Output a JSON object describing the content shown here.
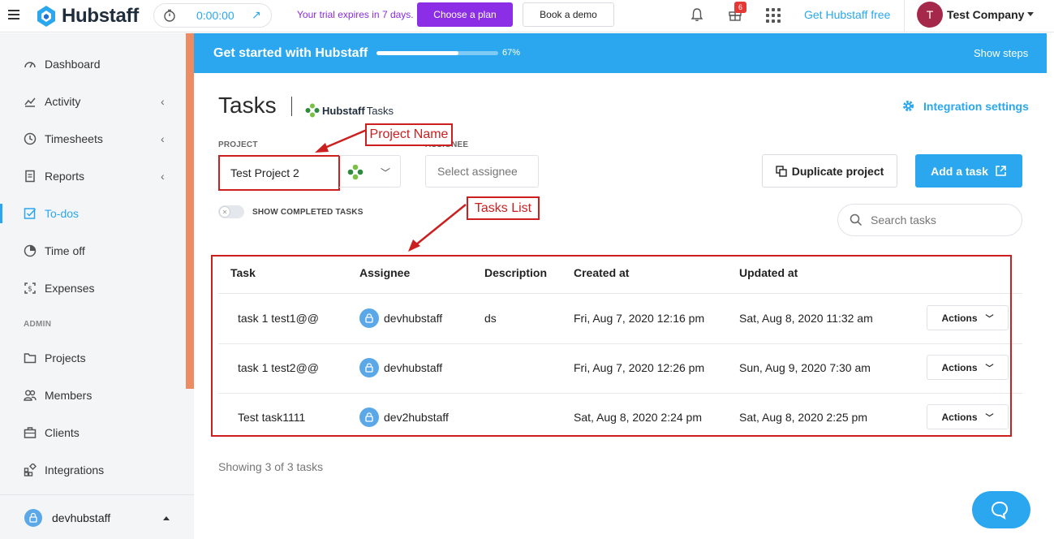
{
  "topbar": {
    "brand": "Hubstaff",
    "timer": "0:00:00",
    "trial_text": "Your trial expires in 7 days.",
    "choose_plan": "Choose a plan",
    "book_demo": "Book a demo",
    "gift_badge": "6",
    "free_link": "Get Hubstaff free",
    "avatar_initial": "T",
    "company": "Test Company"
  },
  "sidebar": {
    "items": [
      {
        "label": "Dashboard"
      },
      {
        "label": "Activity"
      },
      {
        "label": "Timesheets"
      },
      {
        "label": "Reports"
      },
      {
        "label": "To-dos"
      },
      {
        "label": "Time off"
      },
      {
        "label": "Expenses"
      }
    ],
    "admin_title": "ADMIN",
    "admin_items": [
      {
        "label": "Projects"
      },
      {
        "label": "Members"
      },
      {
        "label": "Clients"
      },
      {
        "label": "Integrations"
      }
    ],
    "user": "devhubstaff"
  },
  "banner": {
    "title": "Get started with Hubstaff",
    "progress": 0.67,
    "progress_label": "67%",
    "show_steps": "Show steps"
  },
  "page": {
    "title": "Tasks",
    "brand_bold": "Hubstaff",
    "brand_regular": "Tasks",
    "integration_settings": "Integration settings",
    "project_label": "PROJECT",
    "project_value": "Test Project 2",
    "assignee_label": "ASSIGNEE",
    "assignee_placeholder": "Select assignee",
    "duplicate_project": "Duplicate project",
    "add_task": "Add a task",
    "show_completed": "SHOW COMPLETED TASKS",
    "search_placeholder": "Search tasks",
    "showing": "Showing 3 of 3 tasks"
  },
  "table": {
    "headers": [
      "Task",
      "Assignee",
      "Description",
      "Created at",
      "Updated at"
    ],
    "rows": [
      {
        "task": "task 1 test1@@",
        "assignee": "devhubstaff",
        "description": "ds",
        "created": "Fri, Aug 7, 2020 12:16 pm",
        "updated": "Sat, Aug 8, 2020 11:32 am",
        "actions": "Actions"
      },
      {
        "task": "task 1 test2@@",
        "assignee": "devhubstaff",
        "description": "",
        "created": "Fri, Aug 7, 2020 12:26 pm",
        "updated": "Sun, Aug 9, 2020 7:30 am",
        "actions": "Actions"
      },
      {
        "task": "Test task1111",
        "assignee": "dev2hubstaff",
        "description": "",
        "created": "Sat, Aug 8, 2020 2:24 pm",
        "updated": "Sat, Aug 8, 2020 2:25 pm",
        "actions": "Actions"
      }
    ]
  },
  "annotations": {
    "project_name": "Project Name",
    "tasks_list": "Tasks List"
  },
  "colors": {
    "accent": "#2aa7ee",
    "trial": "#8b2ee6",
    "annotation": "#cc1f1f",
    "sidebar_scroll": "#ed8b62"
  }
}
